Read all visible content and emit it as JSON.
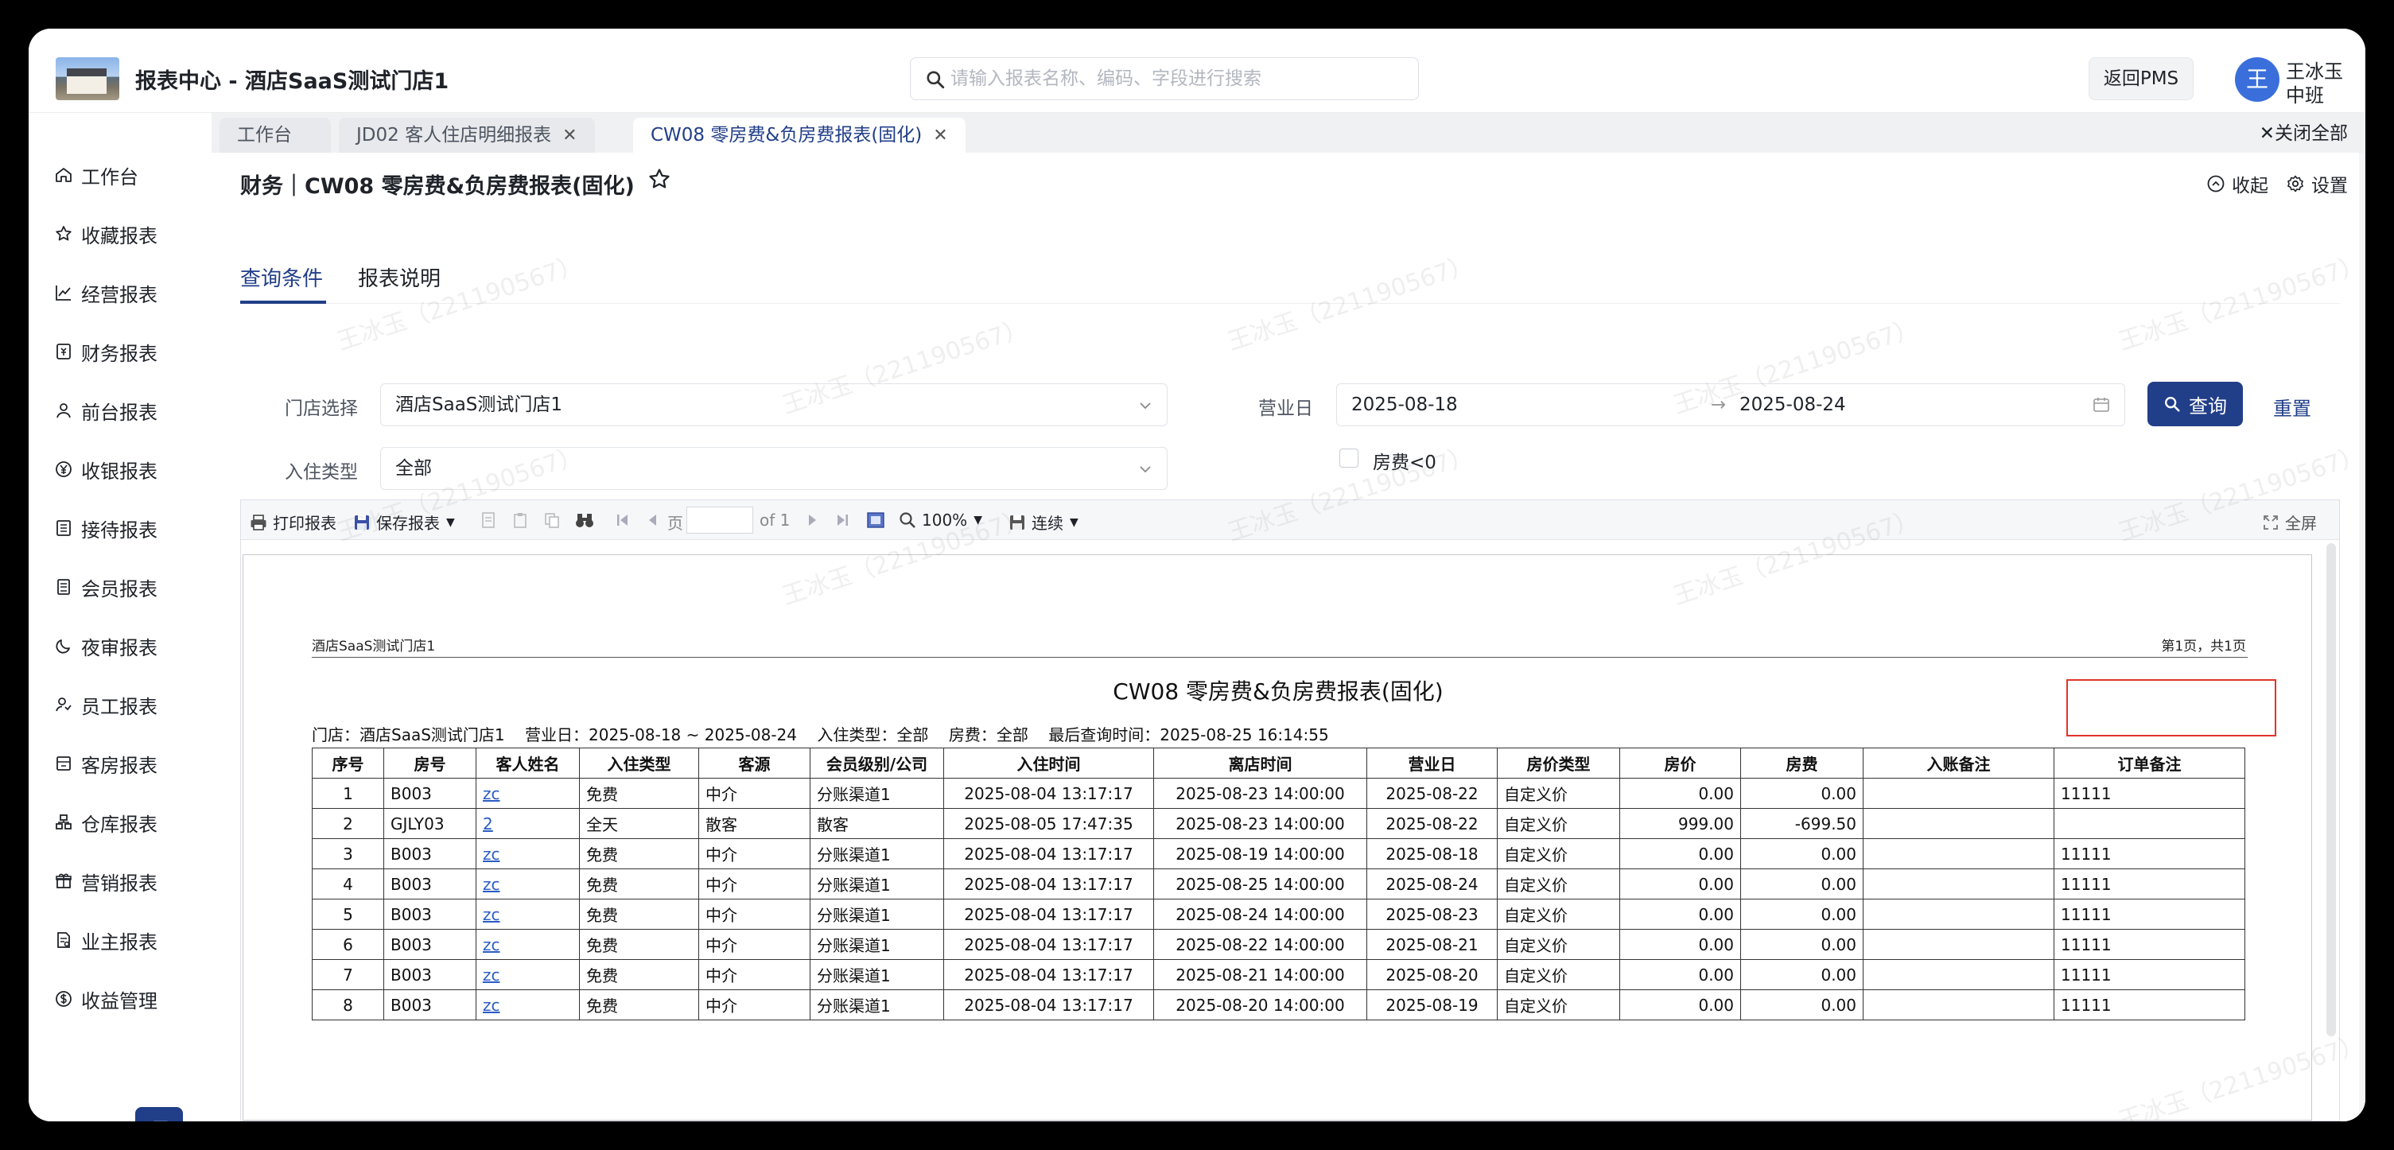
{
  "header": {
    "app_title": "报表中心 - 酒店SaaS测试门店1",
    "search_placeholder": "请输入报表名称、编码、字段进行搜索",
    "back_button": "返回PMS",
    "user": {
      "avatar": "王",
      "name": "王冰玉",
      "shift": "中班"
    }
  },
  "sidebar": {
    "items": [
      {
        "label": "工作台",
        "icon": "home-icon"
      },
      {
        "label": "收藏报表",
        "icon": "star-icon"
      },
      {
        "label": "经营报表",
        "icon": "line-chart-icon"
      },
      {
        "label": "财务报表",
        "icon": "finance-icon"
      },
      {
        "label": "前台报表",
        "icon": "person-icon"
      },
      {
        "label": "收银报表",
        "icon": "yen-icon"
      },
      {
        "label": "接待报表",
        "icon": "list-icon"
      },
      {
        "label": "会员报表",
        "icon": "member-card-icon"
      },
      {
        "label": "夜审报表",
        "icon": "moon-icon"
      },
      {
        "label": "员工报表",
        "icon": "staff-icon"
      },
      {
        "label": "客房报表",
        "icon": "room-icon"
      },
      {
        "label": "仓库报表",
        "icon": "warehouse-icon"
      },
      {
        "label": "营销报表",
        "icon": "gift-icon"
      },
      {
        "label": "业主报表",
        "icon": "owner-doc-icon"
      },
      {
        "label": "收益管理",
        "icon": "dollar-icon"
      }
    ]
  },
  "tabs": [
    {
      "label": "工作台"
    },
    {
      "label": "JD02 客人住店明细报表"
    },
    {
      "label": "CW08 零房费&负房费报表(固化)"
    }
  ],
  "close_all": "关闭全部",
  "page": {
    "title": "财务｜CW08 零房费&负房费报表(固化)",
    "collapse": "收起",
    "settings": "设置",
    "subtabs": [
      "查询条件",
      "报表说明"
    ]
  },
  "form": {
    "store_label": "门店选择",
    "store_value": "酒店SaaS测试门店1",
    "checkin_label": "入住类型",
    "checkin_value": "全部",
    "bizday_label": "营业日",
    "date_from": "2025-08-18",
    "date_to": "2025-08-24",
    "date_sep": "→",
    "negative_label": "房费<0",
    "query": "查询",
    "reset": "重置"
  },
  "toolbar": {
    "print": "打印报表",
    "save": "保存报表",
    "page_label": "页",
    "of_pages": "of 1",
    "zoom": "100%",
    "mode": "连续",
    "fullscreen": "全屏"
  },
  "report": {
    "store": "酒店SaaS测试门店1",
    "page_info": "第1页，共1页",
    "title": "CW08 零房费&负房费报表(固化)",
    "meta": "门店：酒店SaaS测试门店1    营业日：2025-08-18 ~ 2025-08-24    入住类型：全部    房费：全部    最后查询时间：2025-08-25 16:14:55",
    "columns": [
      "序号",
      "房号",
      "客人姓名",
      "入住类型",
      "客源",
      "会员级别/公司",
      "入住时间",
      "离店时间",
      "营业日",
      "房价类型",
      "房价",
      "房费",
      "入账备注",
      "订单备注"
    ],
    "rows": [
      [
        "1",
        "B003",
        "zc",
        "免费",
        "中介",
        "分账渠道1",
        "2025-08-04 13:17:17",
        "2025-08-23 14:00:00",
        "2025-08-22",
        "自定义价",
        "0.00",
        "0.00",
        "",
        "11111"
      ],
      [
        "2",
        "GJLY03",
        "2",
        "全天",
        "散客",
        "散客",
        "2025-08-05 17:47:35",
        "2025-08-23 14:00:00",
        "2025-08-22",
        "自定义价",
        "999.00",
        "-699.50",
        "",
        ""
      ],
      [
        "3",
        "B003",
        "zc",
        "免费",
        "中介",
        "分账渠道1",
        "2025-08-04 13:17:17",
        "2025-08-19 14:00:00",
        "2025-08-18",
        "自定义价",
        "0.00",
        "0.00",
        "",
        "11111"
      ],
      [
        "4",
        "B003",
        "zc",
        "免费",
        "中介",
        "分账渠道1",
        "2025-08-04 13:17:17",
        "2025-08-25 14:00:00",
        "2025-08-24",
        "自定义价",
        "0.00",
        "0.00",
        "",
        "11111"
      ],
      [
        "5",
        "B003",
        "zc",
        "免费",
        "中介",
        "分账渠道1",
        "2025-08-04 13:17:17",
        "2025-08-24 14:00:00",
        "2025-08-23",
        "自定义价",
        "0.00",
        "0.00",
        "",
        "11111"
      ],
      [
        "6",
        "B003",
        "zc",
        "免费",
        "中介",
        "分账渠道1",
        "2025-08-04 13:17:17",
        "2025-08-22 14:00:00",
        "2025-08-21",
        "自定义价",
        "0.00",
        "0.00",
        "",
        "11111"
      ],
      [
        "7",
        "B003",
        "zc",
        "免费",
        "中介",
        "分账渠道1",
        "2025-08-04 13:17:17",
        "2025-08-21 14:00:00",
        "2025-08-20",
        "自定义价",
        "0.00",
        "0.00",
        "",
        "11111"
      ],
      [
        "8",
        "B003",
        "zc",
        "免费",
        "中介",
        "分账渠道1",
        "2025-08-04 13:17:17",
        "2025-08-20 14:00:00",
        "2025-08-19",
        "自定义价",
        "0.00",
        "0.00",
        "",
        "11111"
      ]
    ]
  },
  "watermark": "王冰玉（221190567）",
  "colors": {
    "primary": "#213e88",
    "highlight": "#e0352b",
    "link": "#2a5cc4"
  }
}
